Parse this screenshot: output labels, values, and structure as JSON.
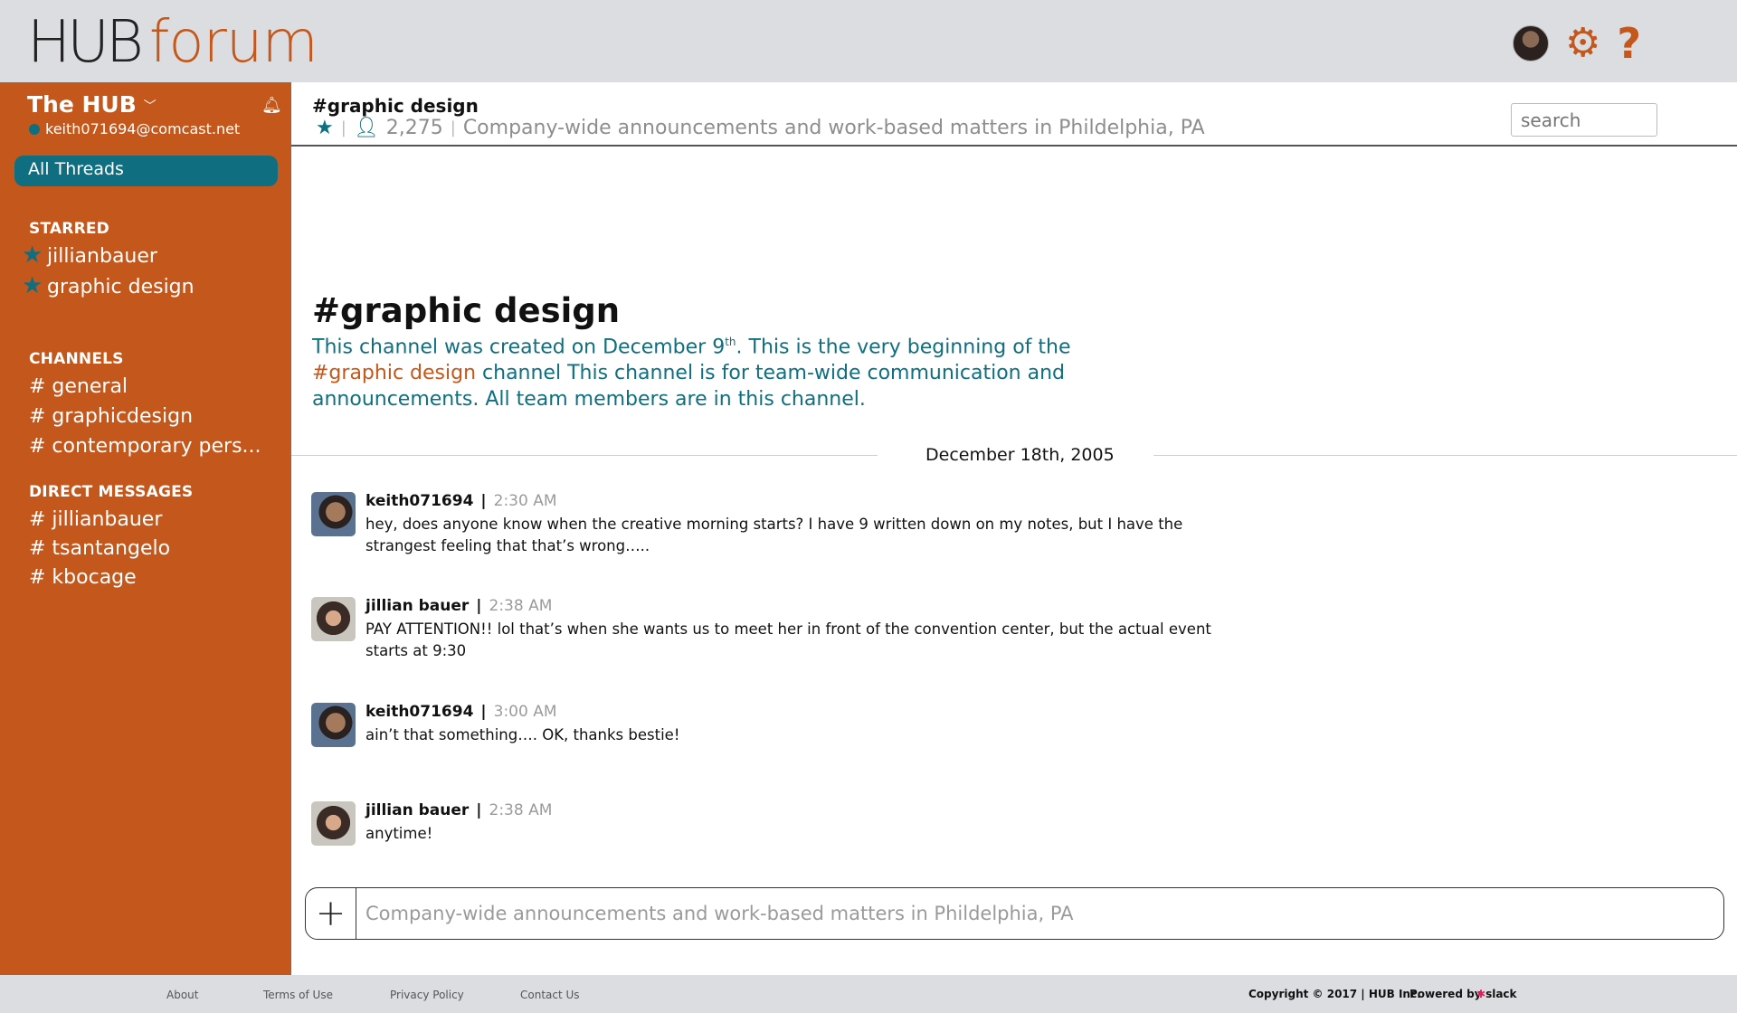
{
  "brand": {
    "hub": "HUB",
    "forum": "forum"
  },
  "colors": {
    "accent": "#c4571b",
    "teal": "#0f6f80",
    "topbar": "#dcdde0"
  },
  "top_icons": [
    "user-avatar",
    "gear-icon",
    "help-icon",
    "menu-icon"
  ],
  "sidebar": {
    "team": "The HUB",
    "user_email": "keith071694@comcast.net",
    "all_threads": "All Threads",
    "starred_header": "STARRED",
    "starred": [
      "jillianbauer",
      "graphic design"
    ],
    "channels_header": "CHANNELS",
    "channels": [
      "# general",
      "# graphicdesign",
      "# contemporary pers..."
    ],
    "dm_header": "DIRECT MESSAGES",
    "dms": [
      "# jillianbauer",
      "# tsantangelo",
      "# kbocage"
    ]
  },
  "channel": {
    "title": "#graphic design",
    "members": "2,275",
    "description": "Company-wide announcements and work-based matters in Phildelphia, PA",
    "search_placeholder": "search"
  },
  "intro": {
    "title": "#graphic design",
    "text_1": "This channel was created on December 9",
    "sup": "th",
    "text_2": ". This is the very beginning of the ",
    "highlight": "#graphic design",
    "text_3": " channel This channel is for team-wide communication and announcements. All team members are in this channel."
  },
  "date_divider": "December 18th, 2005",
  "messages": [
    {
      "name": "keith071694",
      "time": "2:30 AM",
      "text": "hey, does anyone know when the creative morning starts? I have 9 written down on my notes, but I have the strangest feeling that that’s wrong….."
    },
    {
      "name": "jillian bauer",
      "time": "2:38 AM",
      "text": "PAY ATTENTION!! lol that’s when she wants us to meet her in front of the convention center, but the actual event starts at 9:30"
    },
    {
      "name": "keith071694",
      "time": "3:00 AM",
      "text": "ain’t that something….  OK, thanks bestie!"
    },
    {
      "name": "jillian bauer",
      "time": "2:38 AM",
      "text": "anytime!"
    }
  ],
  "composer": {
    "placeholder": "Company-wide announcements and work-based matters in Phildelphia, PA"
  },
  "footer": {
    "about": "About",
    "terms": "Terms of Use",
    "privacy": "Privacy Policy",
    "contact": "Contact Us",
    "copyright": "Copyright © 2017 |  HUB Inc.",
    "powered": "Powered by",
    "slack": "slack"
  }
}
